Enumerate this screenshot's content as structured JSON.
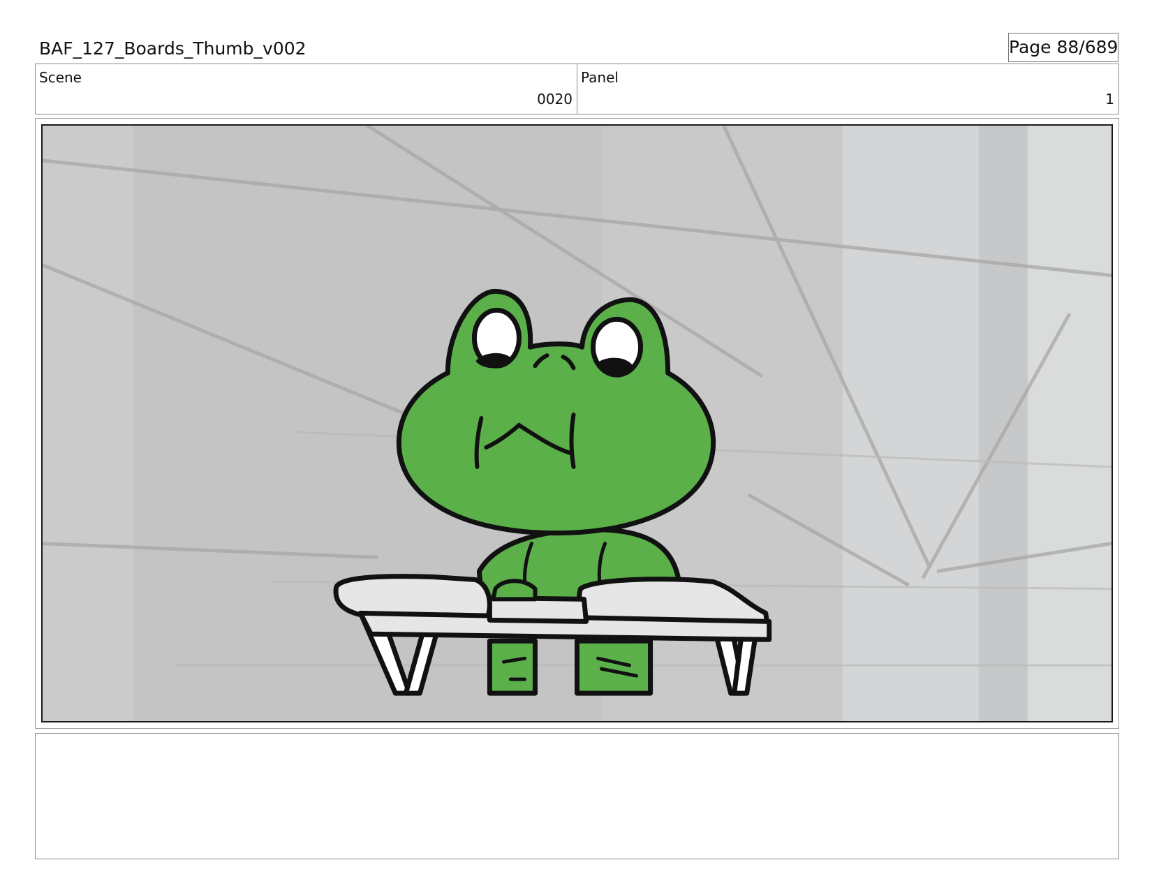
{
  "header": {
    "title": "BAF_127_Boards_Thumb_v002",
    "page_label": "Page",
    "page_number": "88/689"
  },
  "scene": {
    "label": "Scene",
    "value": "0020"
  },
  "panel": {
    "label": "Panel",
    "value": "1"
  },
  "notes": {
    "text": ""
  },
  "colors": {
    "frog_green": "#5bb04a",
    "line": "#111111",
    "background_gray": "#c4c4c4",
    "desk_white": "#e6e6e6"
  }
}
